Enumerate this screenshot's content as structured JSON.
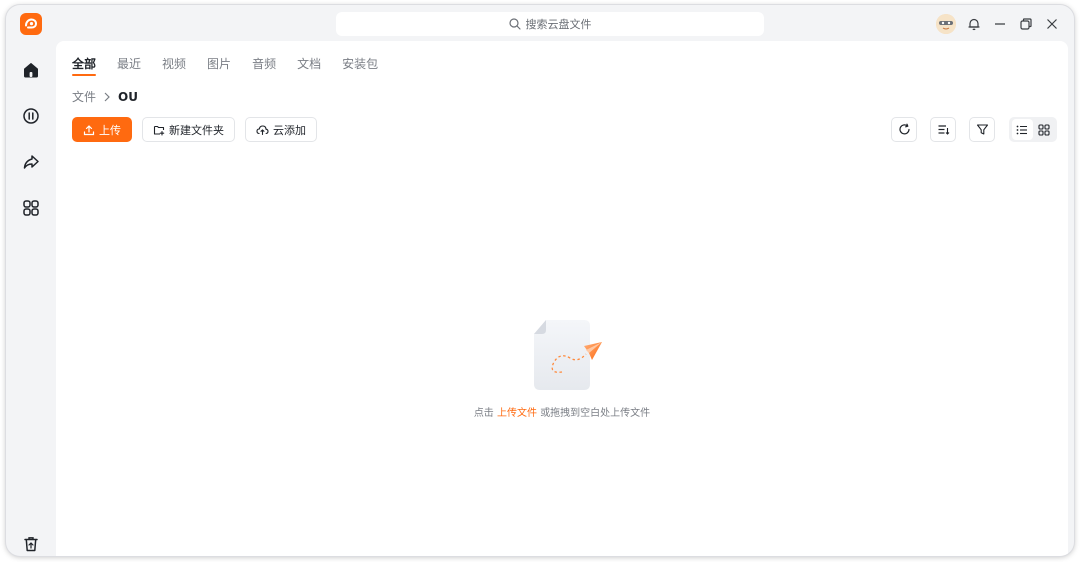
{
  "titlebar": {
    "search_placeholder": "搜索云盘文件",
    "icons": [
      "logo-icon",
      "avatar-icon",
      "bell-icon",
      "minimize-icon",
      "restore-icon",
      "close-icon"
    ]
  },
  "sidebar": {
    "items": [
      {
        "icon": "home-icon"
      },
      {
        "icon": "recent-circle-icon"
      },
      {
        "icon": "share-icon"
      },
      {
        "icon": "apps-icon"
      }
    ],
    "bottom_icon": "recycle-bin-icon"
  },
  "tabs": [
    {
      "label": "全部",
      "active": true
    },
    {
      "label": "最近"
    },
    {
      "label": "视频"
    },
    {
      "label": "图片"
    },
    {
      "label": "音频"
    },
    {
      "label": "文档"
    },
    {
      "label": "安装包"
    }
  ],
  "breadcrumb": {
    "root": "文件",
    "current": "OU"
  },
  "actions": {
    "upload": "上传",
    "new_folder": "新建文件夹",
    "cloud_add": "云添加"
  },
  "tools": [
    "refresh-icon",
    "sort-icon",
    "filter-icon",
    "list-view-icon",
    "grid-view-icon"
  ],
  "empty": {
    "prefix": "点击",
    "link": "上传文件",
    "suffix": "或拖拽到空白处上传文件"
  },
  "colors": {
    "accent": "#ff6a10",
    "text": "#1f2329",
    "muted": "#7a7e85"
  }
}
